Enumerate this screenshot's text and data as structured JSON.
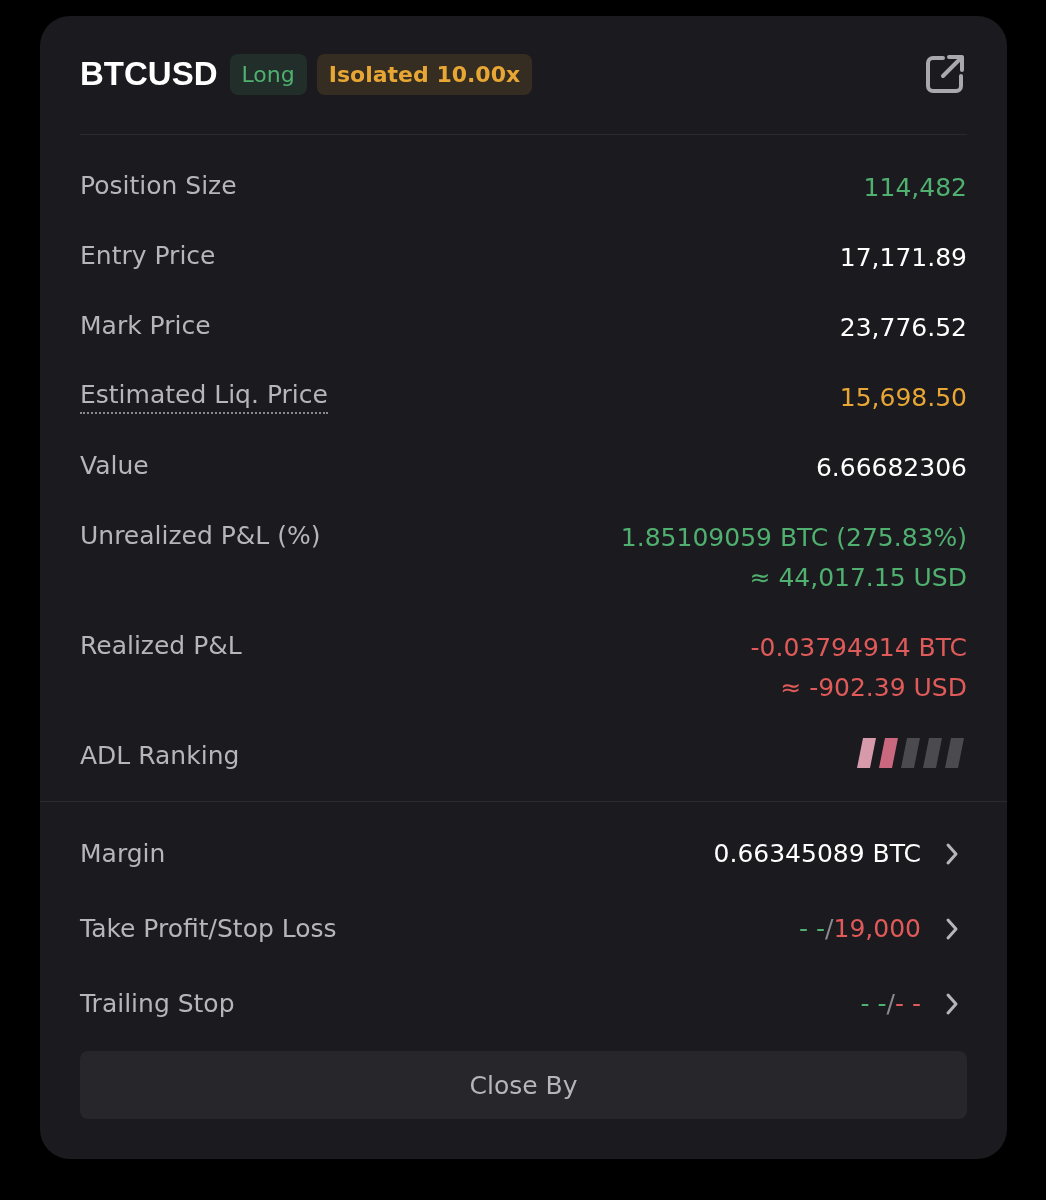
{
  "header": {
    "symbol": "BTCUSD",
    "tags": [
      {
        "text": "Long",
        "color": "#4fb06f"
      },
      {
        "text": "Isolated 10.00x",
        "color": "#e8a735"
      }
    ]
  },
  "rows": [
    {
      "kind": "text",
      "label": "Position Size",
      "underlined": false,
      "lines": [
        {
          "text": "114,482",
          "color": "#4fb06f"
        }
      ]
    },
    {
      "kind": "text",
      "label": "Entry Price",
      "underlined": false,
      "lines": [
        {
          "text": "17,171.89",
          "color": "#ffffff"
        }
      ]
    },
    {
      "kind": "text",
      "label": "Mark Price",
      "underlined": false,
      "lines": [
        {
          "text": "23,776.52",
          "color": "#ffffff"
        }
      ]
    },
    {
      "kind": "text",
      "label": "Estimated Liq. Price",
      "underlined": true,
      "lines": [
        {
          "text": "15,698.50",
          "color": "#e8a735"
        }
      ]
    },
    {
      "kind": "text",
      "label": "Value",
      "underlined": false,
      "lines": [
        {
          "text": "6.66682306",
          "color": "#ffffff"
        }
      ]
    },
    {
      "kind": "text",
      "label": "Unrealized P&L (%)",
      "underlined": false,
      "lines": [
        {
          "text": "1.85109059 BTC (275.83%)",
          "color": "#4fb06f"
        },
        {
          "text": "≈ 44,017.15 USD",
          "color": "#4fb06f"
        }
      ]
    },
    {
      "kind": "text",
      "label": "Realized P&L",
      "underlined": false,
      "lines": [
        {
          "text": "-0.03794914 BTC",
          "color": "#e05a5a"
        },
        {
          "text": "≈ -902.39 USD",
          "color": "#e05a5a"
        }
      ]
    },
    {
      "kind": "meter",
      "label": "ADL Ranking",
      "level": 0.4
    }
  ],
  "links": [
    {
      "label": "Margin",
      "parts": [
        {
          "text": "0.66345089 BTC",
          "color": "#ffffff"
        }
      ]
    },
    {
      "label": "Take Profit/Stop Loss",
      "parts": [
        {
          "text": "- -",
          "color": "#4fb06f"
        },
        {
          "text": "/",
          "color": "#8a8a8e"
        },
        {
          "text": "19,000",
          "color": "#e05a5a"
        }
      ]
    },
    {
      "label": "Trailing Stop",
      "parts": [
        {
          "text": "- -",
          "color": "#4fb06f"
        },
        {
          "text": "/",
          "color": "#8a8a8e"
        },
        {
          "text": "- -",
          "color": "#e05a5a"
        }
      ]
    }
  ],
  "button": "Close By"
}
